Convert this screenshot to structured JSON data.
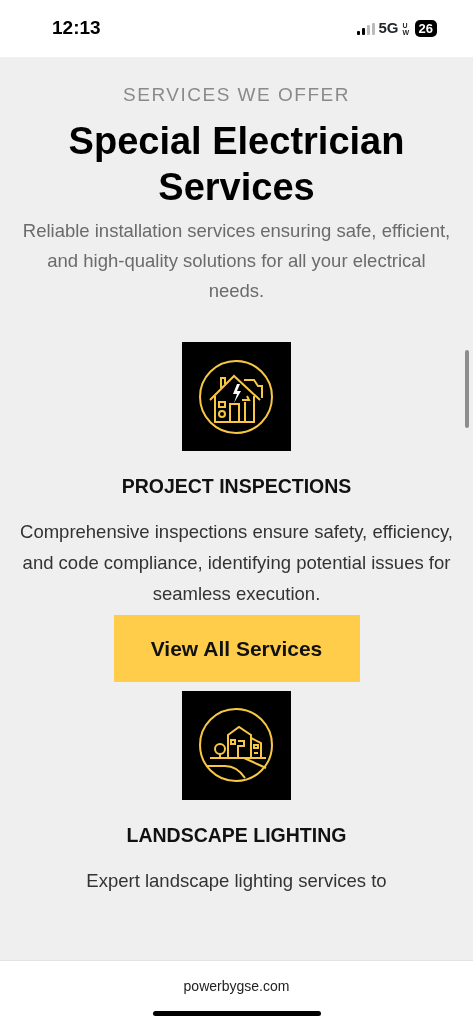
{
  "status_bar": {
    "time": "12:13",
    "network": "5G",
    "network_suffix": "UW",
    "battery": "26"
  },
  "section": {
    "eyebrow": "SERVICES WE OFFER",
    "title": "Special Electrician Services",
    "description": "Reliable installation services ensuring safe, efficient, and high-quality solutions for all your electrical needs."
  },
  "services": [
    {
      "kind": "inspection",
      "title": "PROJECT INSPECTIONS",
      "description": "Comprehensive inspections ensure safety, efficiency, and code compliance, identifying potential issues for seamless execution."
    },
    {
      "kind": "button",
      "label": "View All Services"
    },
    {
      "kind": "landscape",
      "title": "LANDSCAPE LIGHTING",
      "description": "Expert landscape lighting services to"
    }
  ],
  "browser": {
    "url": "powerbygse.com"
  }
}
